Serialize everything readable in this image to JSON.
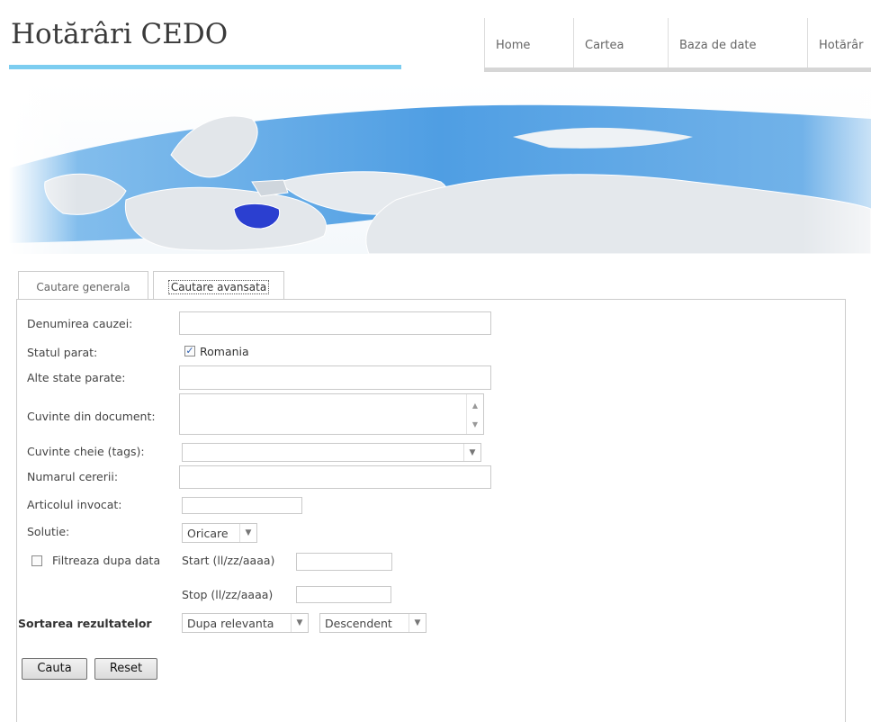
{
  "header": {
    "site_title": "Hotărâri CEDO",
    "nav": [
      "Home",
      "Cartea",
      "Baza de date",
      "Hotărâr"
    ]
  },
  "tabs": [
    {
      "label": "Cautare generala",
      "active": false
    },
    {
      "label": "Cautare avansata",
      "active": true
    }
  ],
  "form": {
    "denumirea_label": "Denumirea cauzei:",
    "statul_label": "Statul parat:",
    "statul_checkbox_label": "Romania",
    "statul_checked": true,
    "alte_label": "Alte state parate:",
    "cuvinte_doc_label": "Cuvinte din document:",
    "tags_label": "Cuvinte cheie (tags):",
    "numarul_label": "Numarul cererii:",
    "articol_label": "Articolul invocat:",
    "solutie_label": "Solutie:",
    "solutie_value": "Oricare",
    "filtreaza_label": "Filtreaza dupa data",
    "filtreaza_checked": false,
    "start_label": "Start (ll/zz/aaaa)",
    "stop_label": "Stop (ll/zz/aaaa)",
    "sortare_label": "Sortarea rezultatelor",
    "sort_by_value": "Dupa relevanta",
    "sort_order_value": "Descendent"
  },
  "buttons": {
    "search": "Cauta",
    "reset": "Reset"
  },
  "icons": {
    "dropdown": "chevron-down-icon",
    "checkmark": "checkmark-icon"
  },
  "colors": {
    "accent_rule": "#7ccdf0",
    "highlight_country": "#2b3fd0",
    "map_sea": "#6aaee6"
  }
}
